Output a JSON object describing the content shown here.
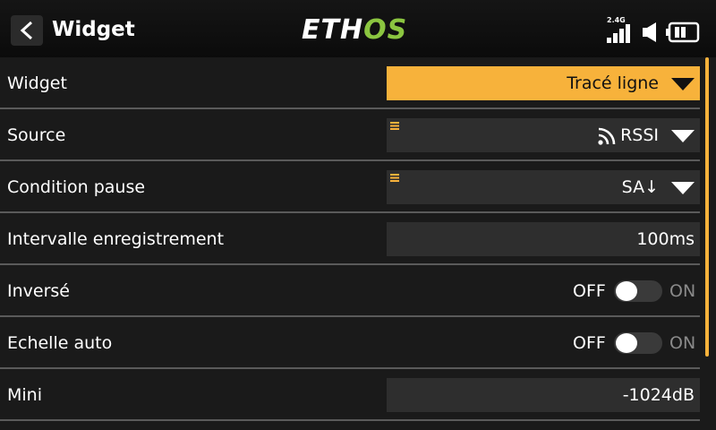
{
  "header": {
    "title": "Widget",
    "logo_left": "ETH",
    "logo_right": "OS",
    "band": "2.4G",
    "icons": [
      "back-arrow-icon",
      "signal-bars-icon",
      "volume-icon",
      "battery-icon"
    ]
  },
  "rows": [
    {
      "label": "Widget",
      "value": "Tracé ligne",
      "type": "dropdown",
      "active": true
    },
    {
      "label": "Source",
      "value": "RSSI",
      "type": "dropdown",
      "icon": "rss-icon"
    },
    {
      "label": "Condition pause",
      "value": "SA↓",
      "type": "dropdown"
    },
    {
      "label": "Intervalle enregistrement",
      "value": "100ms",
      "type": "number"
    },
    {
      "label": "Inversé",
      "type": "toggle",
      "off_label": "OFF",
      "on_label": "ON",
      "state": "off"
    },
    {
      "label": "Echelle auto",
      "type": "toggle",
      "off_label": "OFF",
      "on_label": "ON",
      "state": "off"
    },
    {
      "label": "Mini",
      "value": "-1024dB",
      "type": "number"
    }
  ],
  "colors": {
    "accent": "#f7b23b",
    "logo_green": "#8bc540",
    "field_bg": "#2e2e2e",
    "background": "#1a1a1a"
  }
}
